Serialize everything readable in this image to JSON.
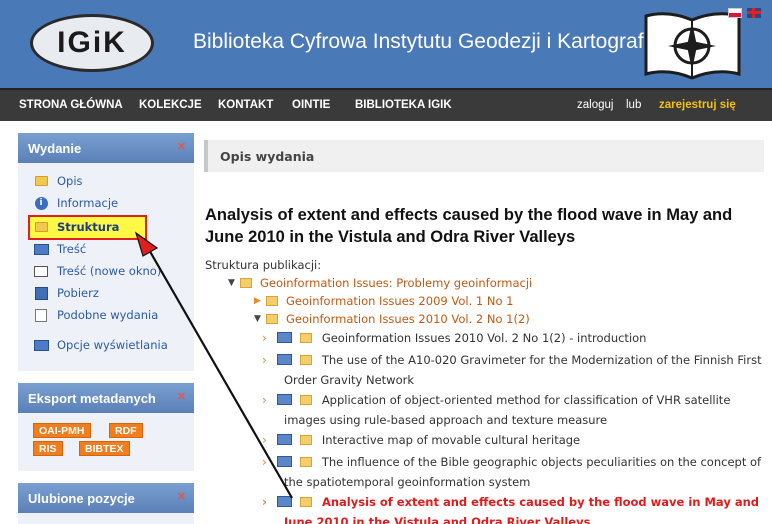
{
  "header": {
    "logo_text": "IGiK",
    "title": "Biblioteka Cyfrowa Instytutu Geodezji i Kartografii"
  },
  "nav": {
    "items": [
      "STRONA GŁÓWNA",
      "KOLEKCJE",
      "KONTAKT",
      "OINTIE",
      "BIBLIOTEKA IGIK"
    ],
    "login": "zaloguj",
    "or": "lub",
    "register": "zarejestruj się"
  },
  "sidebar": {
    "wydanie": {
      "title": "Wydanie",
      "items": [
        {
          "label": "Opis",
          "icon": "folder-icon"
        },
        {
          "label": "Informacje",
          "icon": "info-icon"
        },
        {
          "label": "Struktura",
          "icon": "structure-icon"
        },
        {
          "label": "Treść",
          "icon": "book-icon"
        },
        {
          "label": "Treść (nowe okno)",
          "icon": "new-window-icon"
        },
        {
          "label": "Pobierz",
          "icon": "save-icon"
        },
        {
          "label": "Podobne wydania",
          "icon": "document-icon"
        },
        {
          "label": "Opcje wyświetlania",
          "icon": "display-options-icon"
        }
      ]
    },
    "export": {
      "title": "Eksport metadanych",
      "buttons": [
        "OAI-PMH",
        "RDF",
        "RIS",
        "BIBTEX"
      ]
    },
    "favorites": {
      "title": "Ulubione pozycje"
    }
  },
  "main": {
    "section_header": "Opis wydania",
    "title": "Analysis of extent and effects caused by the flood wave in May and June 2010 in the Vistula and Odra River Valleys",
    "structure_label": "Struktura publikacji:",
    "tree": {
      "root": "Geoinformation Issues: Problemy geoinformacji",
      "vol1": "Geoinformation Issues 2009 Vol. 1 No 1",
      "vol2": "Geoinformation Issues 2010 Vol. 2 No 1(2)",
      "articles": [
        "Geoinformation Issues 2010 Vol. 2 No 1(2) - introduction",
        "The use of the A10-020 Gravimeter for the Modernization of the Finnish First Order Gravity Network",
        "Application of object-oriented method for classification of VHR satellite images using rule-based approach and texture measure",
        "Interactive map of movable cultural heritage",
        "The influence of the Bible geographic objects peculiarities on the concept of the spatiotemporal geoinformation system",
        "Analysis of extent and effects caused by the flood wave in May and June 2010 in the Vistula and Odra River Valleys"
      ]
    }
  },
  "colors": {
    "header_bg": "#4a79b7",
    "nav_bg": "#3a3a3a",
    "register_link": "#f4c20d",
    "highlight_fill": "#fff845",
    "highlight_border": "#e02020",
    "active_article": "#e01b1b",
    "export_buttons": "#f07d1e"
  }
}
